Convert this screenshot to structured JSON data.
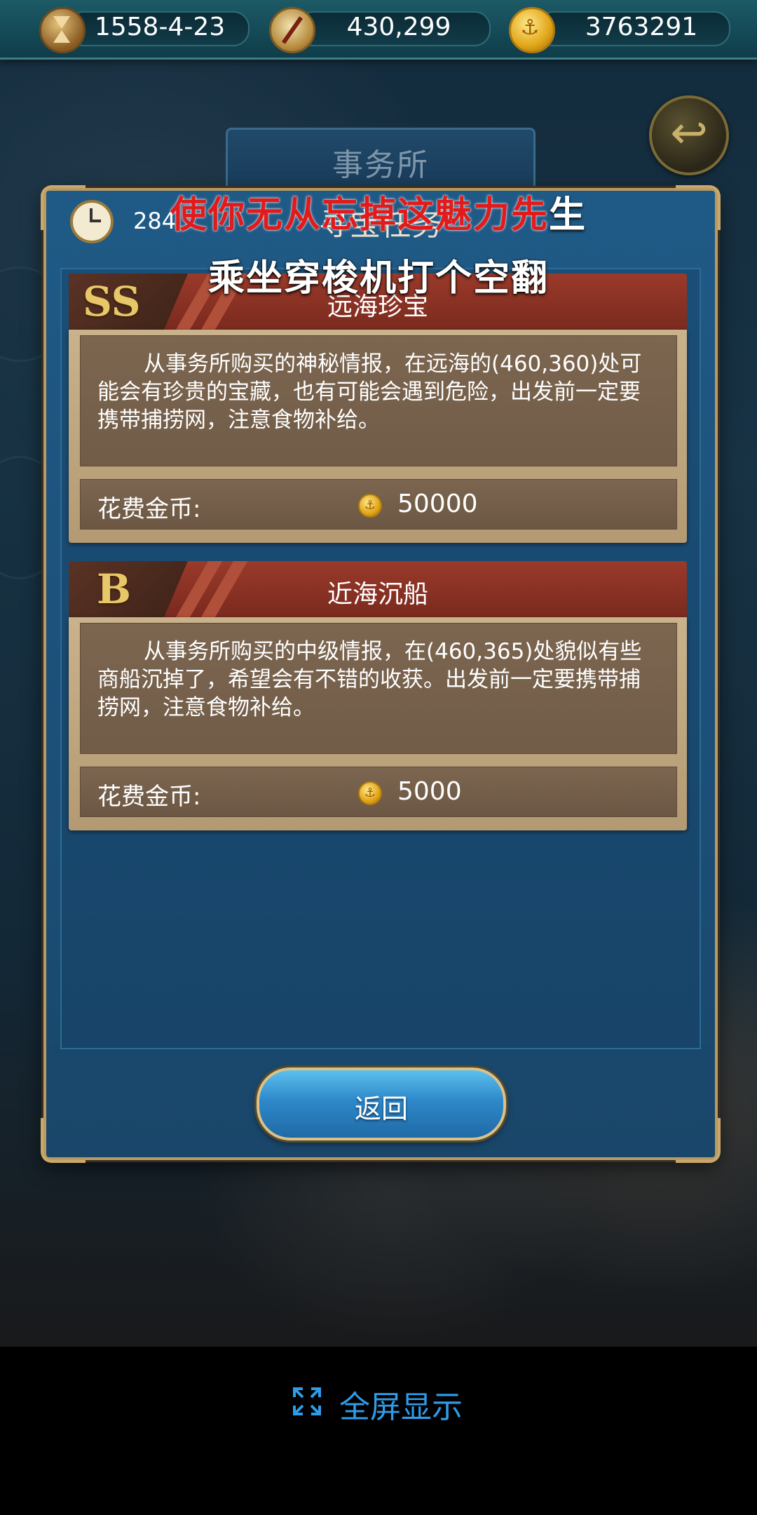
{
  "topbar": {
    "date": "1558-4-23",
    "compass_value": "430,299",
    "gold_value": "3763291",
    "icons": [
      "hourglass-icon",
      "compass-icon",
      "gold-coin-icon"
    ]
  },
  "header": {
    "title": "事务所"
  },
  "dialog": {
    "timer_text": "284",
    "title": "寻宝任务"
  },
  "overlay": {
    "line1_red": "使你无从忘掉这魅力先",
    "line1_tail": "生",
    "line2": "乘坐穿梭机打个空翻"
  },
  "tasks": [
    {
      "grade": "SS",
      "name": "远海珍宝",
      "description": "从事务所购买的神秘情报，在远海的(460,360)处可能会有珍贵的宝藏，也有可能会遇到危险，出发前一定要携带捕捞网，注意食物补给。",
      "cost_label": "花费金币:",
      "cost_value": "50000"
    },
    {
      "grade": "B",
      "name": "近海沉船",
      "description": "从事务所购买的中级情报，在(460,365)处貌似有些商船沉掉了，希望会有不错的收获。出发前一定要携带捕捞网，注意食物补给。",
      "cost_label": "花费金币:",
      "cost_value": "5000"
    }
  ],
  "buttons": {
    "return_label": "返回"
  },
  "system": {
    "fullscreen_label": "全屏显示"
  },
  "colors": {
    "dialog_blue": "#1f5a86",
    "card_header_red": "#9a3a2a",
    "grade_gold": "#e8c769",
    "caption_red": "#e11b1b",
    "fullscreen_blue": "#2f9ce8"
  }
}
